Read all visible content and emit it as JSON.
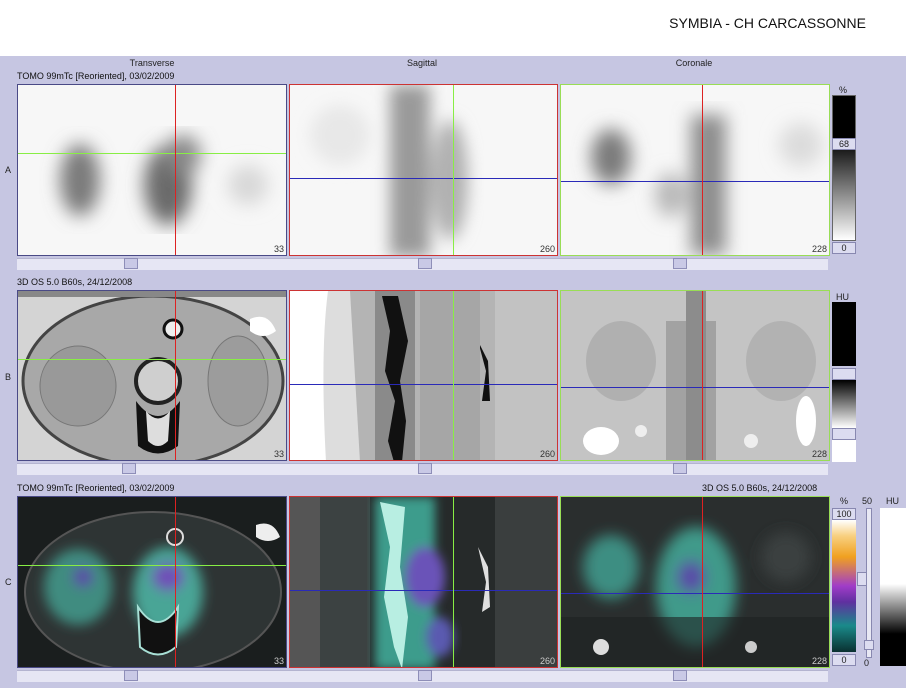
{
  "header": {
    "title": "SYMBIA - CH CARCASSONNE"
  },
  "columns": {
    "transverse": "Transverse",
    "sagittal": "Sagittal",
    "coronal": "Coronale"
  },
  "rows": {
    "a": {
      "label": "A",
      "info": "TOMO 99mTc [Reoriented], 03/02/2009"
    },
    "b": {
      "label": "B",
      "info": "3D  OS  5.0  B60s, 24/12/2008"
    },
    "c": {
      "label": "C",
      "info_left": "TOMO 99mTc [Reoriented], 03/02/2009",
      "info_right": "3D  OS  5.0  B60s, 24/12/2008"
    }
  },
  "slices": {
    "a_transverse": "33",
    "a_sagittal": "260",
    "a_coronal": "228",
    "b_transverse": "33",
    "b_sagittal": "260",
    "b_coronal": "228",
    "c_transverse": "33",
    "c_sagittal": "260",
    "c_coronal": "228"
  },
  "scales": {
    "a": {
      "unit": "%",
      "window": "68",
      "min": "0"
    },
    "b": {
      "unit": "HU"
    },
    "c": {
      "unit_pct": "%",
      "max_pct": "100",
      "min_pct": "0",
      "level": "50",
      "unit_hu": "HU",
      "min_level": "0"
    }
  },
  "colors": {
    "transverse_border": "#4a4a86",
    "sagittal_border": "#cc3333",
    "coronal_border": "#99dd55",
    "crosshair_red": "#dd2222",
    "crosshair_green": "#88ee44",
    "crosshair_blue": "#2a2ab8"
  }
}
